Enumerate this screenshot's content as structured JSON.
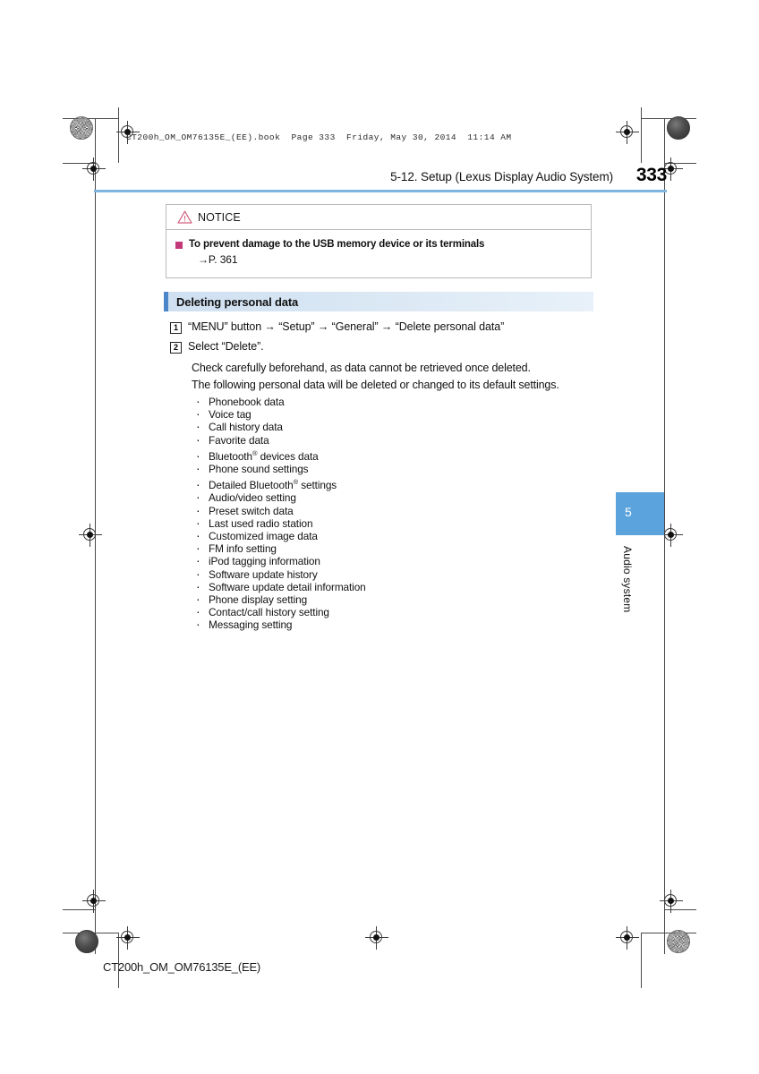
{
  "document": {
    "file_header": "CT200h_OM_OM76135E_(EE).book  Page 333  Friday, May 30, 2014  11:14 AM",
    "footer_code": "CT200h_OM_OM76135E_(EE)",
    "page_number": "333",
    "chapter_title": "5-12. Setup (Lexus Display Audio System)"
  },
  "notice": {
    "title": "NOTICE",
    "warning_icon": "warning-triangle-icon",
    "item_heading": "To prevent damage to the USB memory device or its terminals",
    "item_reference": "→P. 361",
    "bullet_color": "#c2397a",
    "icon_color": "#d46080"
  },
  "section": {
    "heading": "Deleting personal data",
    "accent_color": "#4a86c8",
    "background_color": "#dce9f5"
  },
  "steps": [
    {
      "number": "1",
      "text": "“MENU” button → “Setup” → “General” → “Delete personal data”"
    },
    {
      "number": "2",
      "text": "Select “Delete”."
    }
  ],
  "paragraphs": [
    "Check carefully beforehand, as data cannot be retrieved once deleted.",
    "The following personal data will be deleted or changed to its default settings."
  ],
  "bullets": [
    {
      "text": "Phonebook data",
      "gap": false
    },
    {
      "text": "Voice tag",
      "gap": false
    },
    {
      "text": "Call history data",
      "gap": false
    },
    {
      "text": "Favorite data",
      "gap": false
    },
    {
      "text": "Bluetooth® devices data",
      "gap": true
    },
    {
      "text": "Phone sound settings",
      "gap": false
    },
    {
      "text": "Detailed Bluetooth® settings",
      "gap": true
    },
    {
      "text": "Audio/video setting",
      "gap": false
    },
    {
      "text": "Preset switch data",
      "gap": false
    },
    {
      "text": "Last used radio station",
      "gap": false
    },
    {
      "text": "Customized image data",
      "gap": false
    },
    {
      "text": "FM info setting",
      "gap": false
    },
    {
      "text": "iPod tagging information",
      "gap": false
    },
    {
      "text": "Software update history",
      "gap": false
    },
    {
      "text": "Software update detail information",
      "gap": false
    },
    {
      "text": "Phone display setting",
      "gap": false
    },
    {
      "text": "Contact/call history setting",
      "gap": false
    },
    {
      "text": "Messaging setting",
      "gap": false
    }
  ],
  "side_tab": {
    "number": "5",
    "label": "Audio system",
    "color": "#5ba3dd"
  },
  "rule_color": "#7eb6e0"
}
